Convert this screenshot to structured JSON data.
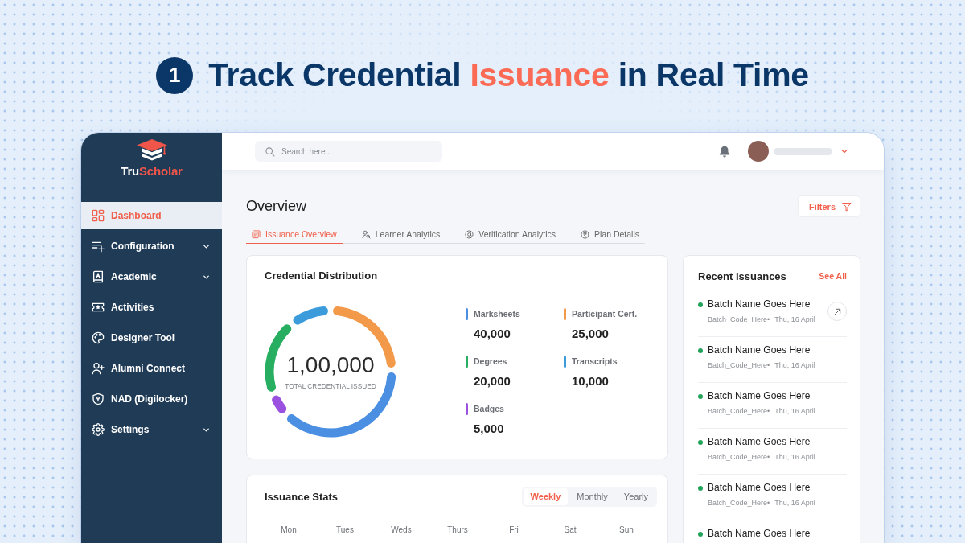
{
  "headline": {
    "step": "1",
    "title": "Track Credential **Issuance** in Real Time"
  },
  "sidebar": {
    "logo": "Tru**Scholar**",
    "items": [
      {
        "label": "Dashboard",
        "selected": true,
        "expandable": false
      },
      {
        "label": "Configuration",
        "selected": false,
        "expandable": true
      },
      {
        "label": "Academic",
        "selected": false,
        "expandable": true
      },
      {
        "label": "Activities",
        "selected": false,
        "expandable": false
      },
      {
        "label": "Designer Tool",
        "selected": false,
        "expandable": false
      },
      {
        "label": "Alumni Connect",
        "selected": false,
        "expandable": false
      },
      {
        "label": "NAD (Digilocker)",
        "selected": false,
        "expandable": false
      },
      {
        "label": "Settings",
        "selected": false,
        "expandable": true
      }
    ]
  },
  "header": {
    "search": {
      "placeholder": "Search here..."
    }
  },
  "overview": {
    "title": "Overview",
    "filters_button": "Filters",
    "tabs": [
      {
        "label": "Issuance Overview",
        "selected": true
      },
      {
        "label": "Learner Analytics",
        "selected": false
      },
      {
        "label": "Verification Analytics",
        "selected": false
      },
      {
        "label": "Plan Details",
        "selected": false
      }
    ]
  },
  "credential_distribution": {
    "title": "Credential Distribution",
    "total": "1,00,000",
    "total_label": "TOTAL CREDENTIAL ISSUED",
    "chart_data": {
      "type": "donut",
      "categories": [
        "Marksheets",
        "Participant Cert.",
        "Degrees",
        "Transcripts",
        "Badges"
      ],
      "values": [
        40,
        25,
        20,
        10,
        5
      ]
    },
    "legend": [
      {
        "value": "40,000",
        "color": "#4a8fe2"
      },
      {
        "value": "25,000",
        "color": "#f2994a"
      },
      {
        "value": "20,000",
        "color": "#27ae60"
      },
      {
        "value": "10,000",
        "color": "#3b9bdb"
      },
      {
        "value": "5,000",
        "color": "#9b51e0"
      }
    ]
  },
  "recent_issuances": {
    "title": "Recent Issuances",
    "see_all": "See All",
    "items": [
      {
        "name": "Batch Name Goes Here",
        "code": "Batch_Code_Here•",
        "date": "Thu, 16 April",
        "hovered": true
      },
      {
        "name": "Batch Name Goes Here",
        "code": "Batch_Code_Here•",
        "date": "Thu, 16 April",
        "hovered": false
      },
      {
        "name": "Batch Name Goes Here",
        "code": "Batch_Code_Here•",
        "date": "Thu, 16 April",
        "hovered": false
      },
      {
        "name": "Batch Name Goes Here",
        "code": "Batch_Code_Here•",
        "date": "Thu, 16 April",
        "hovered": false
      },
      {
        "name": "Batch Name Goes Here",
        "code": "Batch_Code_Here•",
        "date": "Thu, 16 April",
        "hovered": false
      },
      {
        "name": "Batch Name Goes Here",
        "hovered": false
      }
    ]
  },
  "issuance_stats": {
    "title": "Issuance Stats",
    "periods": [
      {
        "label": "Weekly",
        "selected": true
      },
      {
        "label": "Monthly",
        "selected": false
      },
      {
        "label": "Yearly",
        "selected": false
      }
    ],
    "days": [
      "Mon",
      "Tues",
      "Weds",
      "Thurs",
      "Fri",
      "Sat",
      "Sun"
    ]
  }
}
